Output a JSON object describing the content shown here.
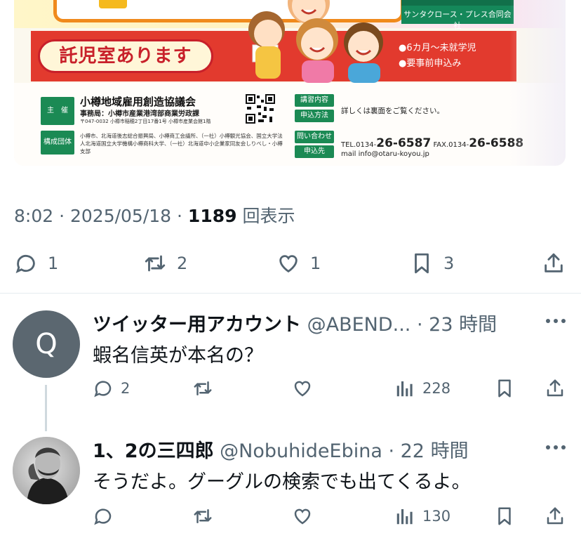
{
  "flyer": {
    "company": "サンタクロース・プレス合同会社",
    "nursery_label": "託児室あります",
    "list": [
      "●6カ月〜未就学児",
      "●要事前申込み"
    ],
    "organizer_tag": "主　催",
    "organizer_name": "小樽地域雇用創造協議会",
    "secretariat": "事務局：小樽市産業港湾部商業労政課",
    "address": "〒047-0032 小樽市稲穂2丁目17番1号 小樽市産業会館1階",
    "members_tag": "構成団体",
    "members": "小樽市、北海道後志総合振興局、小樽商工会議所、（一社）小樽観光協会、国立大学法人北海道国立大学機構小樽商科大学、（一社）北海道中小企業家同友会しりべし・小樽支部",
    "content_tag": "講習内容",
    "apply_tag": "申込方法",
    "note": "詳しくは裏面をご覧ください。",
    "contact_tag": "問い合わせ",
    "apply_to_tag": "申込先",
    "tel_prefix": "TEL.0134-",
    "tel_number": "26-6587",
    "fax_prefix": "FAX.0134-",
    "fax_number": "26-6588",
    "mail": "mail info@otaru-koyou.jp"
  },
  "post_meta": {
    "time_date": "8:02 · 2025/05/18 · ",
    "views": "1189",
    "views_label": " 回表示"
  },
  "post_actions": {
    "replies": "1",
    "reposts": "2",
    "likes": "1",
    "bookmarks": "3"
  },
  "replies": [
    {
      "avatar_letter": "Q",
      "name": "ツイッター用アカウント",
      "handle": "@ABEND...",
      "time": "· 23 時間",
      "text": "蝦名信英が本名の？",
      "replies": "2",
      "views": "228"
    },
    {
      "name": "1、2の三四郎",
      "handle": "@NobuhideEbina",
      "time": "· 22 時間",
      "text": "そうだよ。グーグルの検索でも出てくるよ。",
      "views": "130"
    }
  ],
  "colors": {
    "text": "#0f1419",
    "muted": "#536471",
    "red_banner": "#e23a2e",
    "green": "#1b8a54",
    "orange": "#f08a1c"
  }
}
